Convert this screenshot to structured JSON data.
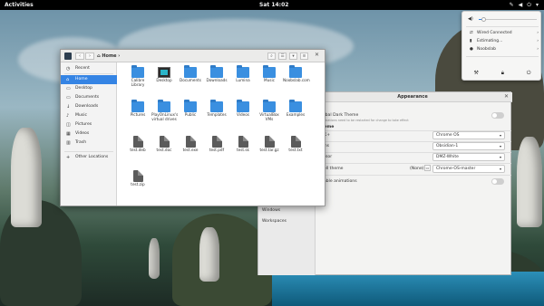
{
  "topbar": {
    "activities": "Activities",
    "clock": "Sat 14:02",
    "tray_icons": [
      "pen-icon",
      "volume-icon",
      "power-icon"
    ]
  },
  "system_menu": {
    "volume_level": 0.08,
    "items": [
      {
        "icon": "network-wired-icon",
        "label": "Wired Connected"
      },
      {
        "icon": "battery-icon",
        "label": "Estimating..."
      },
      {
        "icon": "user-icon",
        "label": "Noobslab"
      }
    ],
    "actions": [
      "settings-icon",
      "lock-icon",
      "power-icon"
    ]
  },
  "files_window": {
    "path": "Home",
    "sidebar": [
      {
        "icon": "clock-icon",
        "label": "Recent"
      },
      {
        "icon": "home-icon",
        "label": "Home",
        "active": true
      },
      {
        "icon": "folder-icon",
        "label": "Desktop"
      },
      {
        "icon": "folder-icon",
        "label": "Documents"
      },
      {
        "icon": "download-icon",
        "label": "Downloads"
      },
      {
        "icon": "music-icon",
        "label": "Music"
      },
      {
        "icon": "camera-icon",
        "label": "Pictures"
      },
      {
        "icon": "film-icon",
        "label": "Videos"
      },
      {
        "icon": "trash-icon",
        "label": "Trash"
      },
      {
        "icon": "plus-icon",
        "label": "Other Locations"
      }
    ],
    "files": [
      {
        "kind": "folder",
        "label": "Calibre Library"
      },
      {
        "kind": "desk",
        "label": "Desktop"
      },
      {
        "kind": "folder",
        "label": "Documents"
      },
      {
        "kind": "folder",
        "label": "Downloads"
      },
      {
        "kind": "folder",
        "label": "Lumina"
      },
      {
        "kind": "folder",
        "label": "Music"
      },
      {
        "kind": "folder",
        "label": "Noobslab.com"
      },
      {
        "kind": "folder",
        "label": "Pictures"
      },
      {
        "kind": "folder",
        "label": "PlayOnLinux's virtual drives"
      },
      {
        "kind": "folder",
        "label": "Public"
      },
      {
        "kind": "folder",
        "label": "Templates"
      },
      {
        "kind": "folder",
        "label": "Videos"
      },
      {
        "kind": "folder",
        "label": "VirtualBox VMs"
      },
      {
        "kind": "folder",
        "label": "Examples"
      },
      {
        "kind": "doc",
        "label": "test.deb"
      },
      {
        "kind": "doc",
        "label": "test.doc"
      },
      {
        "kind": "doc",
        "label": "test.exe"
      },
      {
        "kind": "doc",
        "label": "test.pdf"
      },
      {
        "kind": "doc",
        "label": "test.sk"
      },
      {
        "kind": "doc",
        "label": "test.tar.gz"
      },
      {
        "kind": "doc",
        "label": "test.txt"
      },
      {
        "kind": "doc",
        "label": "test.zip"
      }
    ]
  },
  "appearance_window": {
    "title": "Appearance",
    "sidebar": [
      "Windows",
      "Workspaces"
    ],
    "global_dark": {
      "label": "Global Dark Theme",
      "sub": "Applications need to be restarted for change to take effect",
      "on": false
    },
    "section": "Theme",
    "rows": [
      {
        "label": "GTK+",
        "value": "Chrome OS"
      },
      {
        "label": "Icons",
        "value": "Obsidian-1"
      },
      {
        "label": "Cursor",
        "value": "DMZ-White"
      },
      {
        "label": "Shell theme",
        "value": "Chrome-OS-master",
        "extra": "(None)"
      }
    ],
    "animations": {
      "label": "Enable animations",
      "on": false
    }
  },
  "colors": {
    "accent": "#3584e4",
    "folder": "#3a8fe0"
  }
}
